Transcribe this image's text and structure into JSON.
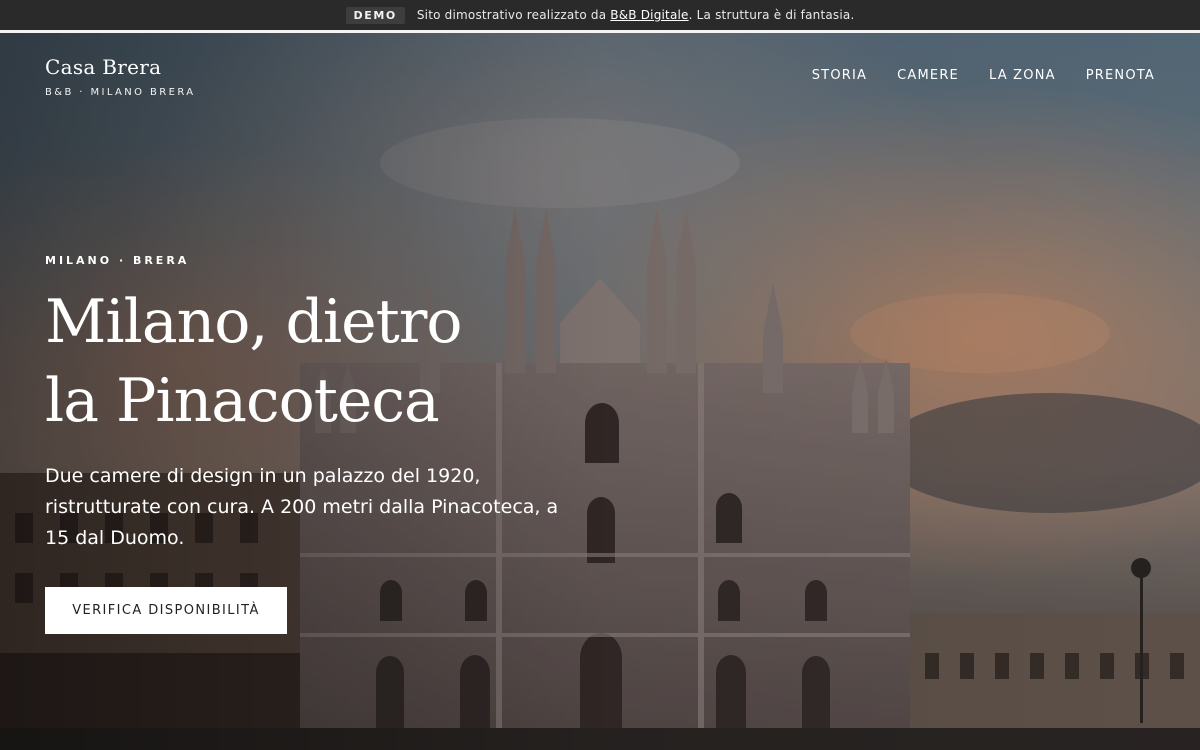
{
  "demo_bar": {
    "badge": "DEMO",
    "text_before": "Sito dimostrativo realizzato da ",
    "link": "B&B Digitale",
    "text_after": ". La struttura è di fantasia."
  },
  "brand": {
    "name": "Casa Brera",
    "subtitle": "B&B · MILANO BRERA"
  },
  "nav": {
    "items": [
      "STORIA",
      "CAMERE",
      "LA ZONA",
      "PRENOTA"
    ]
  },
  "hero": {
    "kicker": "MILANO · BRERA",
    "headline_line1": "Milano, dietro",
    "headline_line2": "la Pinacoteca",
    "lead": "Due camere di design in un palazzo del 1920, ristrutturate con cura. A 200 metri dalla Pinacoteca, a 15 dal Duomo.",
    "cta": "VERIFICA DISPONIBILITÀ",
    "image": "duomo-di-milano-photo"
  },
  "colors": {
    "demo_bar_bg": "#2a2a2a",
    "text_on_hero": "#ffffff",
    "cta_bg": "#ffffff",
    "cta_text": "#222222"
  }
}
